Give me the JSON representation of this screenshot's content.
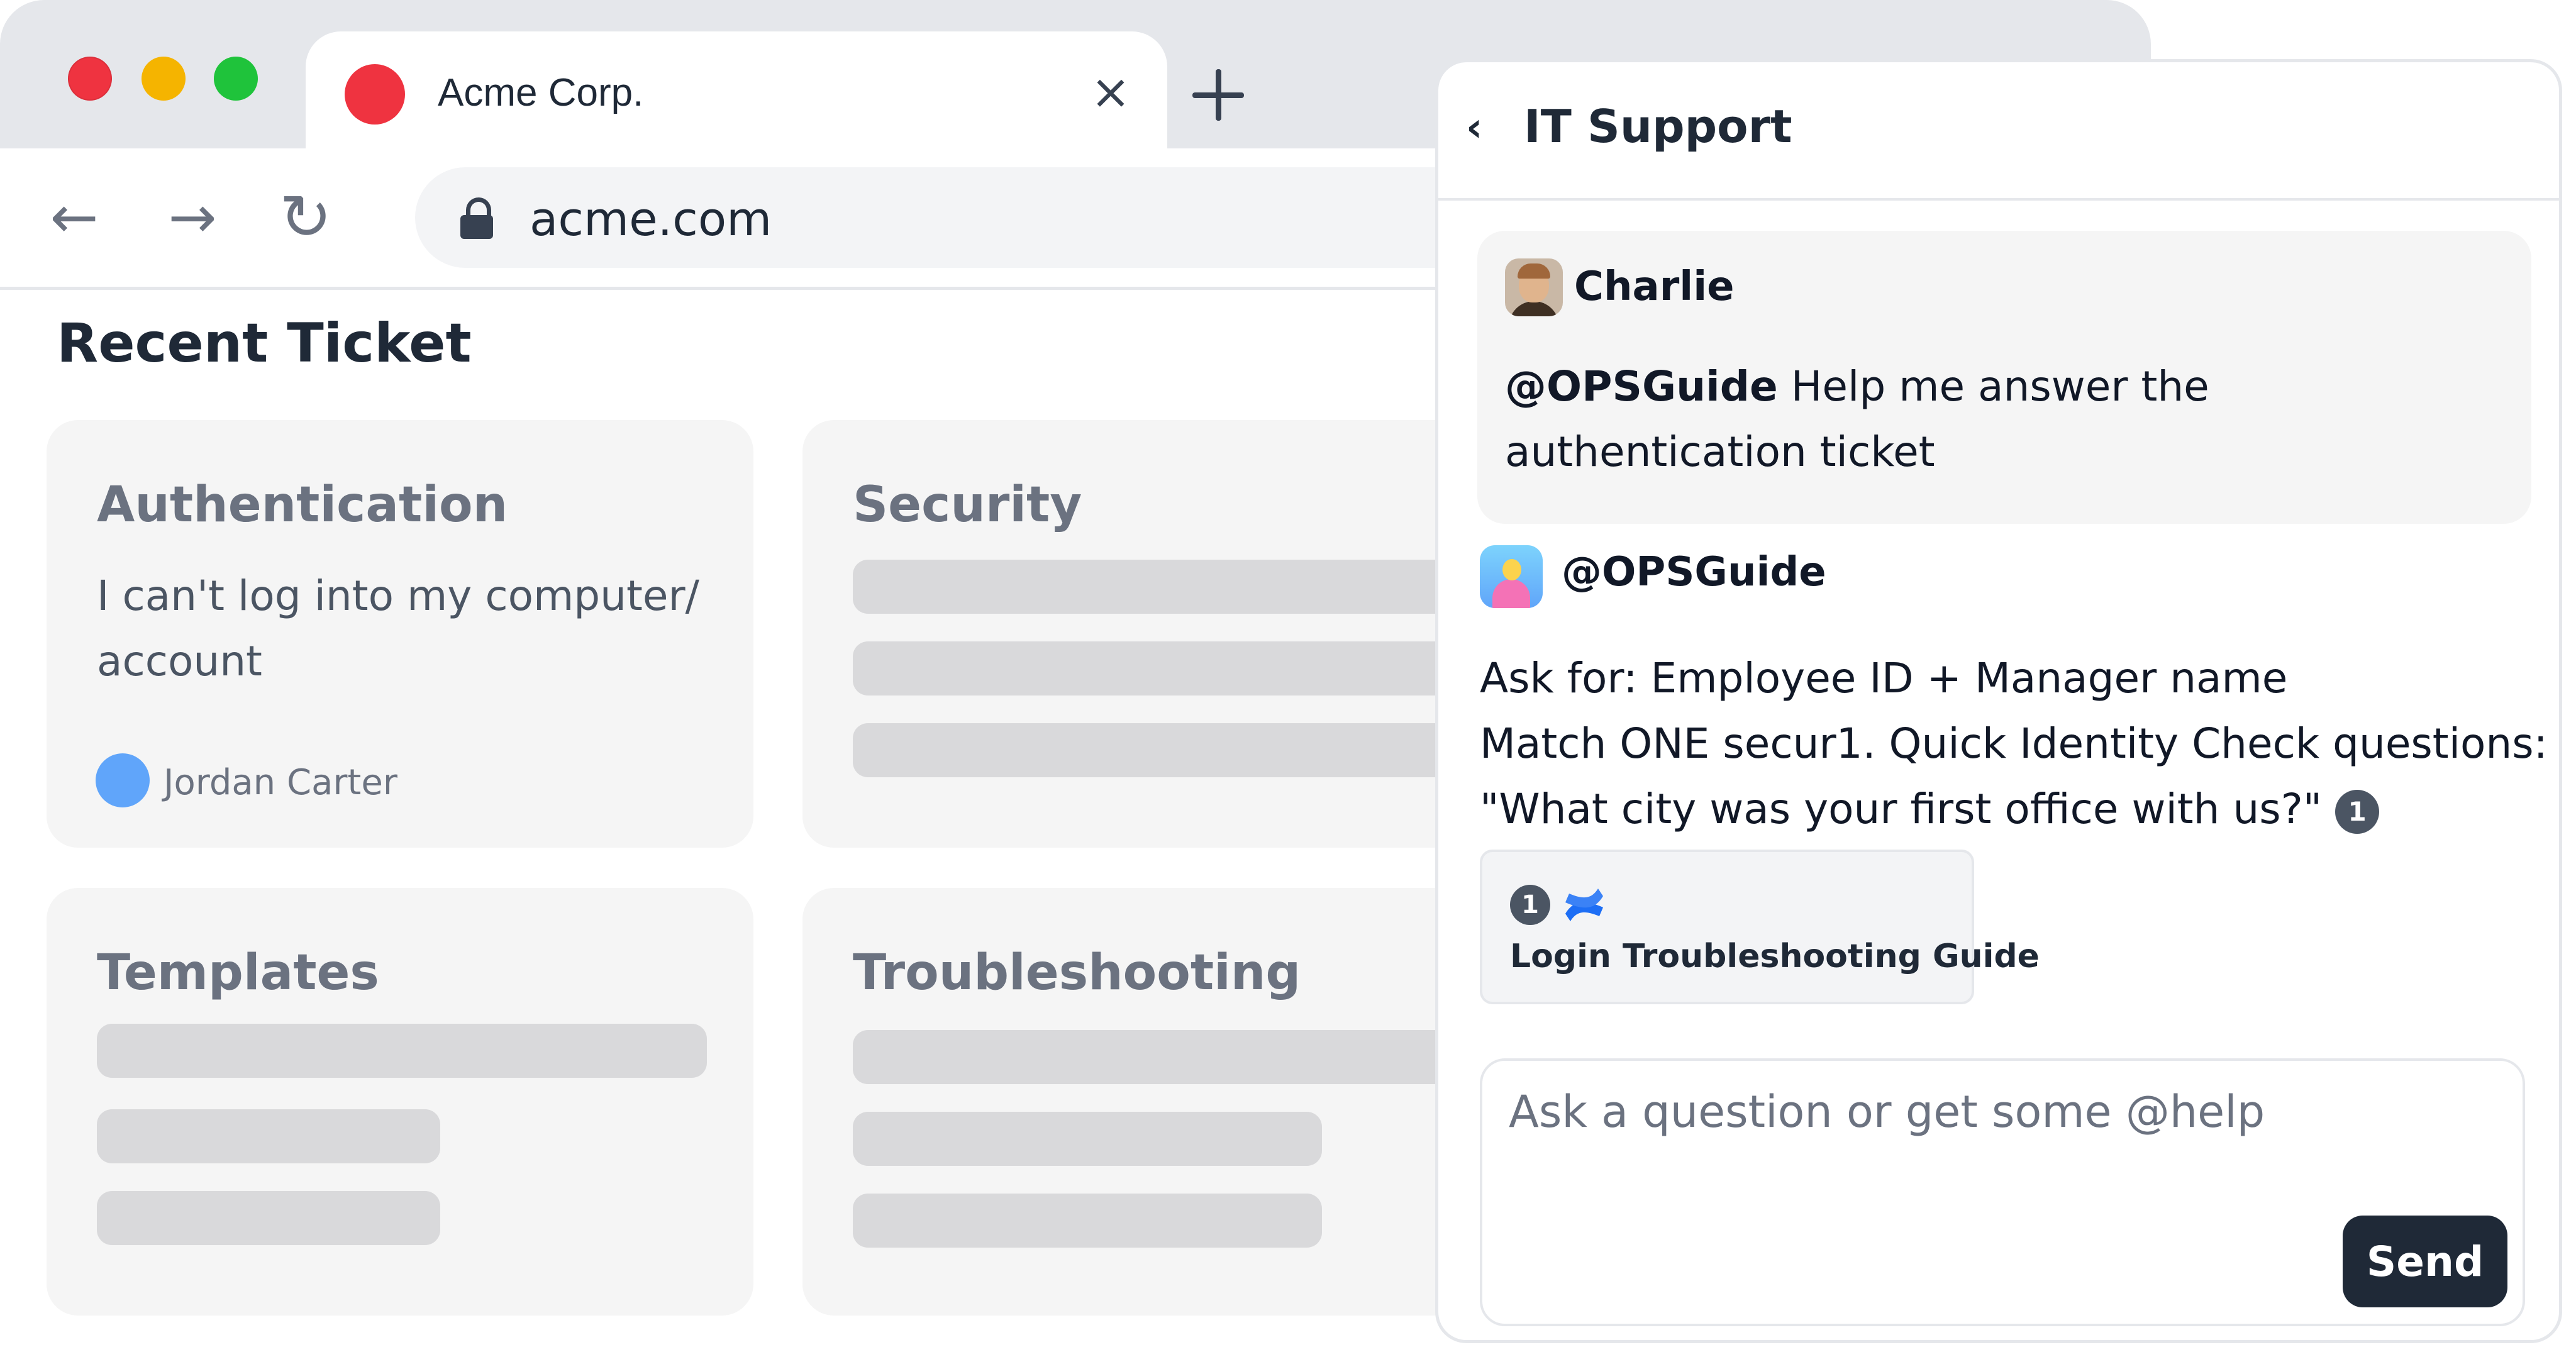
{
  "browser": {
    "tab": {
      "title": "Acme Corp.",
      "close_glyph": "×",
      "favicon_color": "#ef3340"
    },
    "new_tab_icon": "plus-icon",
    "toolbar": {
      "back_glyph": "←",
      "forward_glyph": "→",
      "reload_glyph": "↻",
      "url": "acme.com"
    }
  },
  "page": {
    "title": "Recent Ticket",
    "cards": [
      {
        "title": "Authentication",
        "body": "I can't log into my computer/ account",
        "author": "Jordan Carter"
      },
      {
        "title": "Security"
      },
      {
        "title": "Templates"
      },
      {
        "title": "Troubleshooting"
      }
    ]
  },
  "chat": {
    "back_glyph": "‹",
    "title": "IT Support",
    "messages": [
      {
        "author": "Charlie",
        "mention": "@OPSGuide",
        "text": " Help me answer the authentication ticket"
      },
      {
        "author": "@OPSGuide",
        "lines": [
          "Ask for: Employee ID + Manager name",
          "Match ONE secur1. Quick Identity Check questions:",
          "\"What city was your first office with us?\""
        ],
        "citation": "1"
      }
    ],
    "source": {
      "number": "1",
      "icon": "confluence-icon",
      "title": "Login Troubleshooting Guide"
    },
    "composer": {
      "placeholder": "Ask a question or get some @help",
      "send_label": "Send"
    }
  },
  "colors": {
    "tab_strip": "#e5e7eb",
    "card_bg": "#f5f5f5",
    "skeleton": "#d9d9db",
    "send_button": "#1f2937",
    "author_avatar": "#60a5fa"
  }
}
